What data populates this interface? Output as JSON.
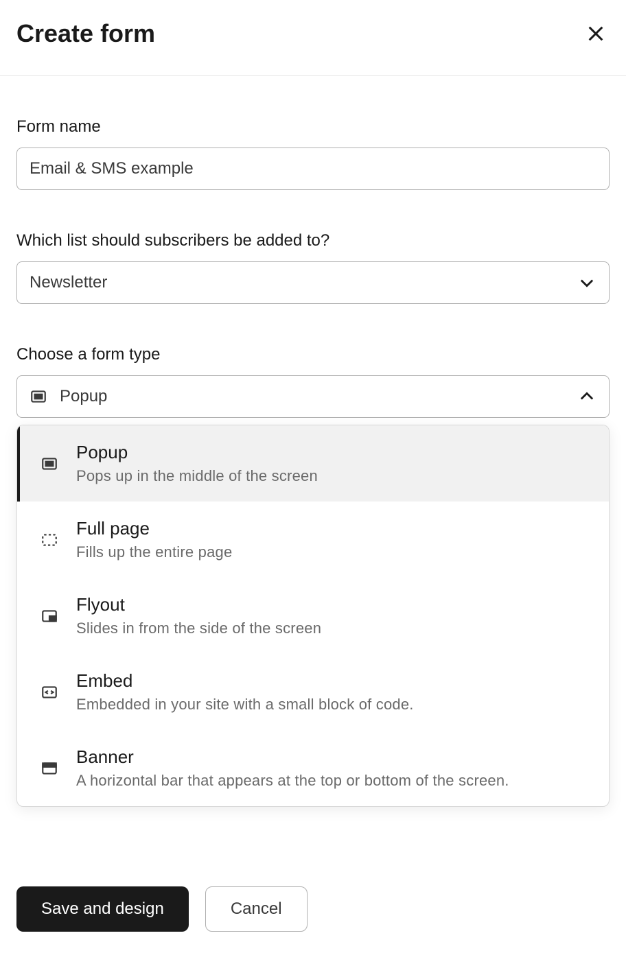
{
  "header": {
    "title": "Create form"
  },
  "form_name": {
    "label": "Form name",
    "value": "Email & SMS example"
  },
  "list_select": {
    "label": "Which list should subscribers be added to?",
    "selected": "Newsletter"
  },
  "form_type": {
    "label": "Choose a form type",
    "selected": "Popup",
    "options": [
      {
        "id": "popup",
        "title": "Popup",
        "desc": "Pops up in the middle of the screen",
        "selected": true
      },
      {
        "id": "fullpage",
        "title": "Full page",
        "desc": "Fills up the entire page",
        "selected": false
      },
      {
        "id": "flyout",
        "title": "Flyout",
        "desc": "Slides in from the side of the screen",
        "selected": false
      },
      {
        "id": "embed",
        "title": "Embed",
        "desc": "Embedded in your site with a small block of code.",
        "selected": false
      },
      {
        "id": "banner",
        "title": "Banner",
        "desc": "A horizontal bar that appears at the top or bottom of the screen.",
        "selected": false
      }
    ]
  },
  "footer": {
    "save": "Save and design",
    "cancel": "Cancel"
  }
}
